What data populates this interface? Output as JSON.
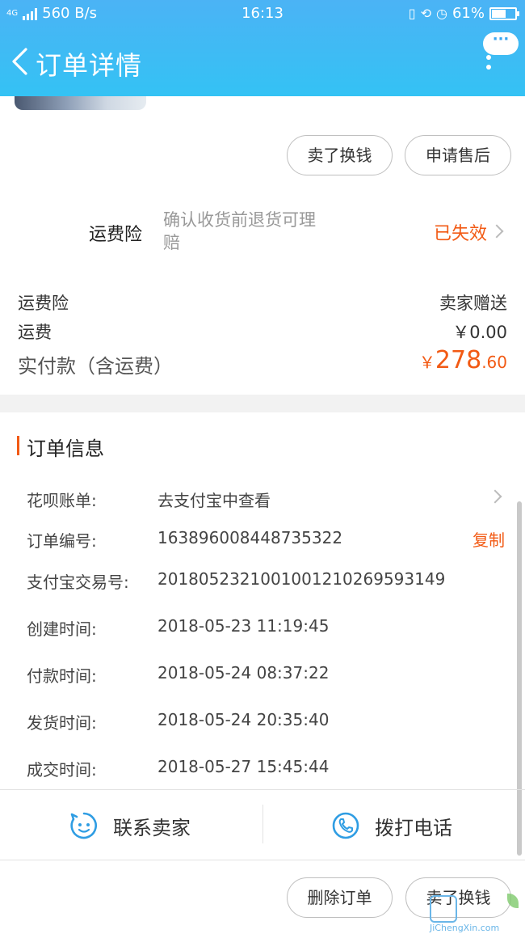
{
  "status_bar": {
    "network_speed": "560 B/s",
    "network_type": "4G",
    "time": "16:13",
    "battery": "61%",
    "battery_level": 0.61
  },
  "nav": {
    "title": "订单详情",
    "more_label": "···"
  },
  "top_actions": {
    "sell_label": "卖了换钱",
    "after_sale_label": "申请售后"
  },
  "insurance": {
    "label": "运费险",
    "desc_line1": "确认收货前退货可理",
    "desc_line2": "赔",
    "status": "已失效"
  },
  "costs": {
    "insurance_label": "运费险",
    "insurance_value": "卖家赠送",
    "shipping_label": "运费",
    "shipping_value": "￥0.00",
    "total_label": "实付款（含运费）",
    "total_currency": "￥",
    "total_int": "278",
    "total_dec": ".60"
  },
  "order_info": {
    "title": "订单信息",
    "huabei_label": "花呗账单:",
    "huabei_value": "去支付宝中查看",
    "order_no_label": "订单编号:",
    "order_no_value": "163896008448735322",
    "copy_label": "复制",
    "alipay_label": "支付宝交易号:",
    "alipay_value": "2018052321001001210269593149",
    "created_label": "创建时间:",
    "created_value": "2018-05-23 11:19:45",
    "paid_label": "付款时间:",
    "paid_value": "2018-05-24 08:37:22",
    "shipped_label": "发货时间:",
    "shipped_value": "2018-05-24 20:35:40",
    "completed_label": "成交时间:",
    "completed_value": "2018-05-27 15:45:44"
  },
  "contact": {
    "seller_label": "联系卖家",
    "phone_label": "拨打电话"
  },
  "bottom_actions": {
    "delete_label": "删除订单",
    "sell_label": "卖了换钱"
  },
  "watermark": {
    "text": "JiChengXin.com"
  },
  "colors": {
    "header": "#3eb8f5",
    "accent": "#f25a14",
    "icon_blue": "#2f9de3"
  }
}
